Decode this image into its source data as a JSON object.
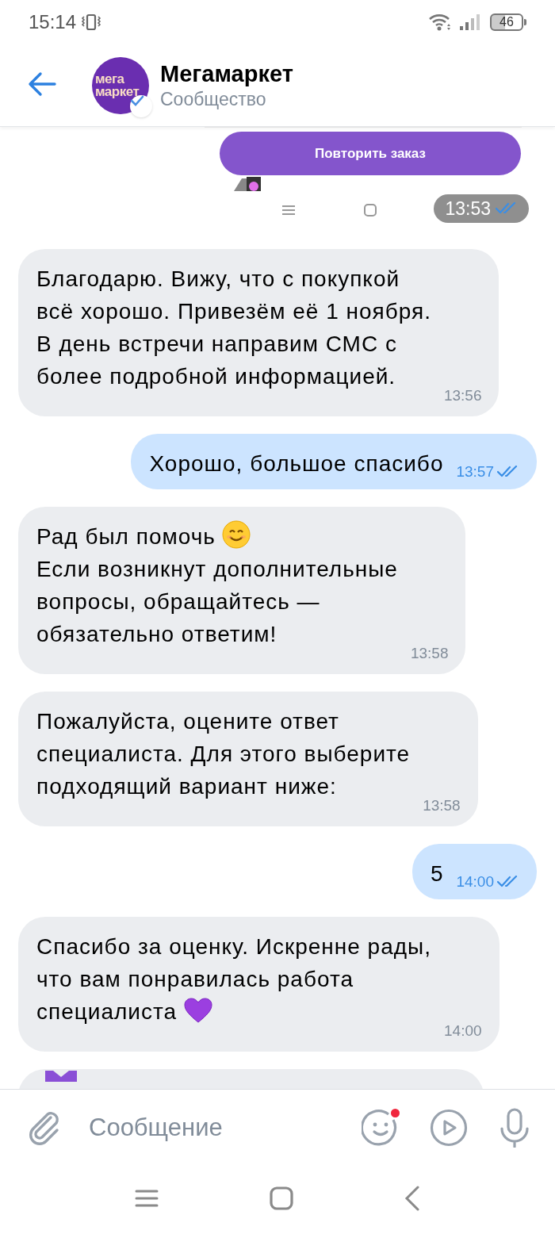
{
  "status_bar": {
    "time": "15:14",
    "battery": "46"
  },
  "header": {
    "title": "Мегамаркет",
    "subtitle": "Сообщество",
    "avatar_lines": [
      "мега",
      "маркет"
    ],
    "verified": true
  },
  "messages": [
    {
      "kind": "image",
      "button": "Повторить заказ",
      "time": "13:53",
      "read": true
    },
    {
      "kind": "text",
      "outgoing": false,
      "paragraphs": [
        {
          "text": "Благодарю. Вижу, что с покупкой\nвсё хорошо. Привезём её 1 ноября.\nВ день встречи направим СМС с\nболее подробной информацией."
        }
      ],
      "time": "13:56"
    },
    {
      "kind": "text",
      "outgoing": true,
      "paragraphs": [
        {
          "text": "Хорошо, большое спасибо"
        }
      ],
      "time": "13:57",
      "read": true
    },
    {
      "kind": "text",
      "outgoing": false,
      "paragraphs": [
        {
          "text": "Рад был помочь",
          "kind": "smile"
        },
        {
          "text": "Если возникнут дополнительные\nвопросы, обращайтесь —\nобязательно ответим!"
        }
      ],
      "time": "13:58"
    },
    {
      "kind": "text",
      "outgoing": false,
      "paragraphs": [
        {
          "text": "Пожалуйста, оцените ответ\nспециалиста. Для этого выберите\nподходящий вариант ниже:"
        }
      ],
      "time": "13:58"
    },
    {
      "kind": "text",
      "outgoing": true,
      "paragraphs": [
        {
          "text": "5"
        }
      ],
      "time": "14:00",
      "read": true
    },
    {
      "kind": "text",
      "outgoing": false,
      "paragraphs": [
        {
          "text": "Спасибо за оценку. Искренне рады,\nчто вам понравилась работа"
        },
        {
          "text": "специалиста",
          "kind": "heart"
        }
      ],
      "time": "14:00"
    },
    {
      "kind": "partial"
    }
  ],
  "composer": {
    "placeholder": "Сообщение",
    "emoji_new": true
  }
}
